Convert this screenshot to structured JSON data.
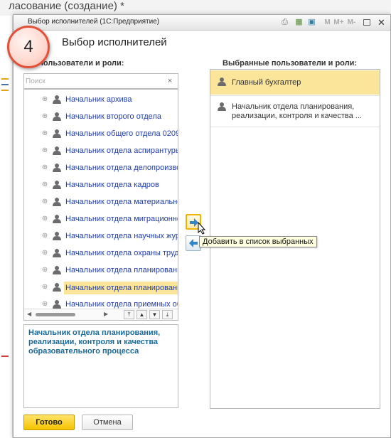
{
  "background": {
    "title": "ласование (создание) *"
  },
  "window": {
    "title": "Выбор исполнителей (1С:Предприятие)",
    "toolbar": {
      "memory_labels": [
        "M",
        "M+",
        "M-"
      ]
    }
  },
  "dialog": {
    "heading": "Выбор исполнителей",
    "step_badge": "4",
    "left_label": "Пользователи и роли:",
    "right_label": "Выбранные пользователи и роли:",
    "search": {
      "placeholder": "Поиск",
      "value": "",
      "clear": "×"
    },
    "tree_items": [
      {
        "label": "Начальник архива",
        "selected": false
      },
      {
        "label": "Начальник второго отдела",
        "selected": false
      },
      {
        "label": "Начальник общего отдела 0209",
        "selected": false
      },
      {
        "label": "Начальник отдела аспирантуры",
        "selected": false
      },
      {
        "label": "Начальник отдела делопроизво",
        "selected": false
      },
      {
        "label": "Начальник отдела кадров",
        "selected": false
      },
      {
        "label": "Начальник отдела материально",
        "selected": false
      },
      {
        "label": "Начальник отдела миграционно",
        "selected": false
      },
      {
        "label": "Начальник отдела научных жур",
        "selected": false
      },
      {
        "label": "Начальник отдела охраны труда",
        "selected": false
      },
      {
        "label": "Начальник отдела планировани",
        "selected": false
      },
      {
        "label": "Начальник отдела планировани",
        "selected": true
      },
      {
        "label": "Начальник отдела приемных об",
        "selected": false
      }
    ],
    "description": "Начальник отдела планирования, реализации, контроля и качества образовательного процесса",
    "selected_items": [
      {
        "label": "Главный бухгалтер",
        "highlight": true
      },
      {
        "label": "Начальник отдела планирования, реализации, контроля и качества ...",
        "highlight": false
      }
    ],
    "tooltip": "Добавить в список выбранных",
    "buttons": {
      "ok": "Готово",
      "cancel": "Отмена"
    },
    "colors": {
      "accent": "#f5c400",
      "selection": "#fbe59a",
      "link": "#1e3cad",
      "description": "#1a6a9a",
      "badge_border": "#e2503a"
    }
  }
}
